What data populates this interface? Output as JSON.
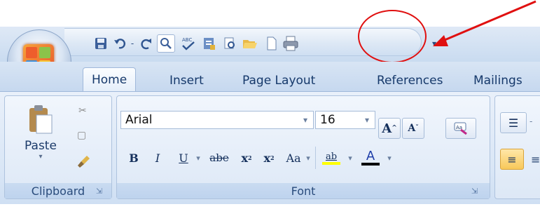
{
  "tabs": [
    "Home",
    "Insert",
    "Page Layout",
    "References",
    "Mailings"
  ],
  "font": {
    "name": "Arial",
    "size": "16",
    "group_label": "Font",
    "bold": "B",
    "italic": "I",
    "underline": "U",
    "strikethrough": "abe",
    "subscript": "x",
    "superscript": "x",
    "change_case": "Aa",
    "highlight": "ab",
    "font_color": "A",
    "grow": "A",
    "shrink": "A"
  },
  "clipboard": {
    "paste_label": "Paste",
    "group_label": "Clipboard"
  },
  "quick_access": [
    "save-icon",
    "undo-icon",
    "redo-icon",
    "print-preview-icon",
    "spelling-icon",
    "new-icon",
    "preview-icon",
    "open-icon",
    "blank-document-icon",
    "print-icon",
    "customize-dropdown-icon"
  ],
  "annotation": {
    "color": "#e01010",
    "target": "print-icon"
  },
  "colors": {
    "ribbon": "#dde8f6",
    "tab_text": "#16396b",
    "highlight": "#ffff00",
    "font_color": "#000000"
  }
}
